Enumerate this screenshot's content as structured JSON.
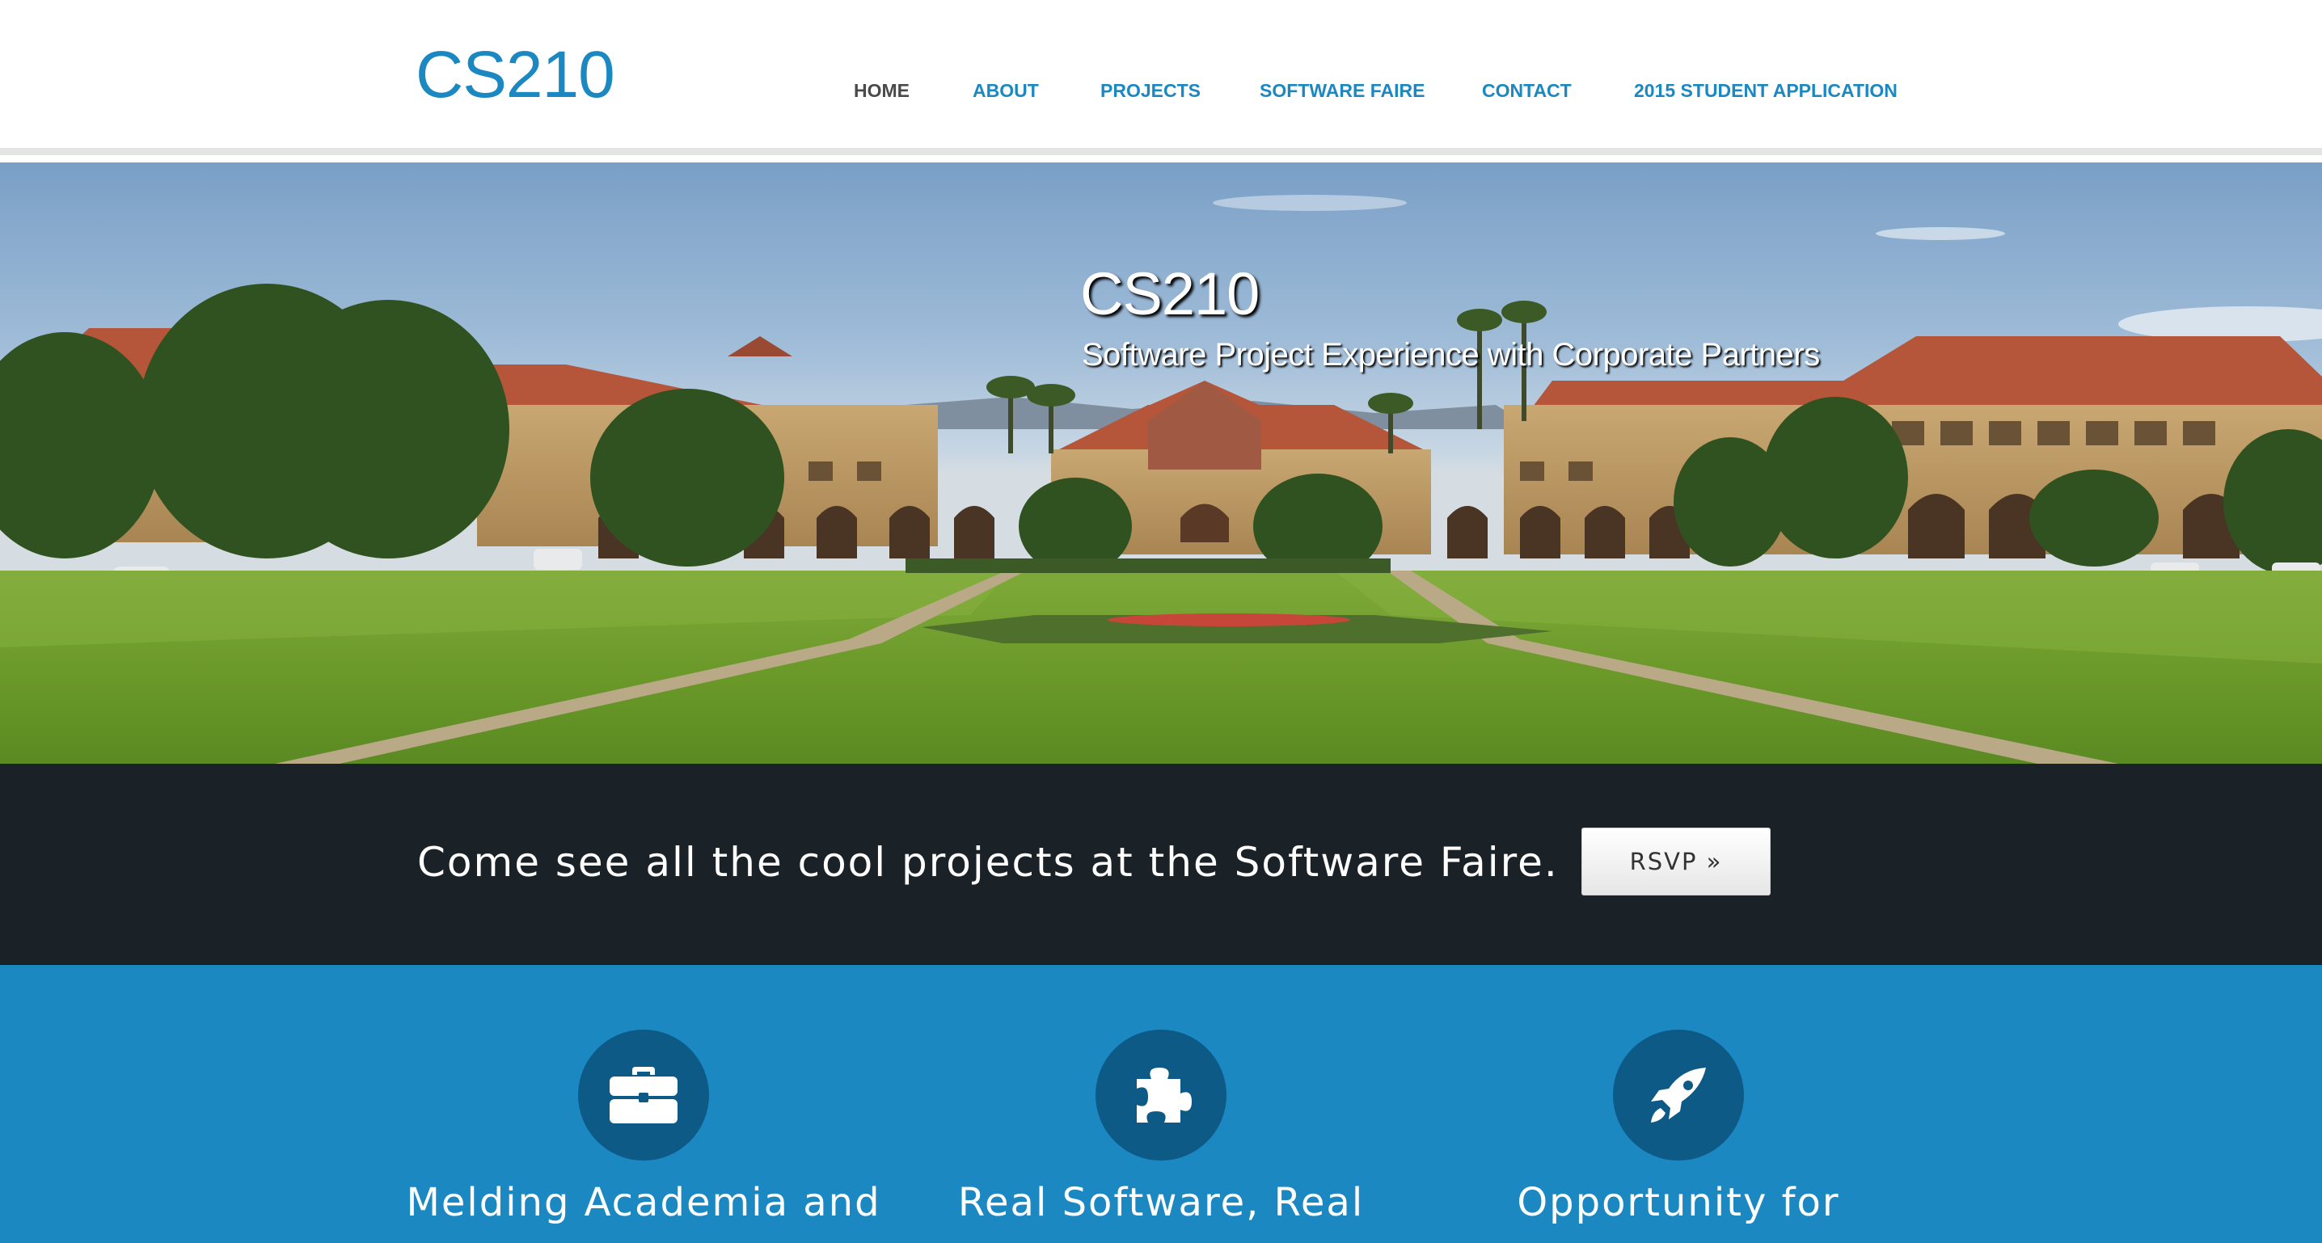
{
  "site": {
    "logo": "CS210"
  },
  "nav": {
    "items": [
      {
        "label": "HOME",
        "active": true
      },
      {
        "label": "ABOUT",
        "active": false
      },
      {
        "label": "PROJECTS",
        "active": false
      },
      {
        "label": "SOFTWARE FAIRE",
        "active": false
      },
      {
        "label": "CONTACT",
        "active": false
      },
      {
        "label": "2015 STUDENT APPLICATION",
        "active": false
      }
    ]
  },
  "hero": {
    "title": "CS210",
    "subtitle": "Software Project Experience with Corporate Partners",
    "image_description_icon": "campus-photo"
  },
  "cta": {
    "text": "Come see all the cool projects at the Software Faire.",
    "button_label": "RSVP »"
  },
  "features": [
    {
      "icon": "briefcase-icon",
      "title": "Melding Academia and"
    },
    {
      "icon": "puzzle-piece-icon",
      "title": "Real Software, Real"
    },
    {
      "icon": "rocket-icon",
      "title": "Opportunity for"
    }
  ],
  "colors": {
    "brand_blue": "#1b88c2",
    "nav_active": "#4a4a4a",
    "cta_background": "#1b2227",
    "icon_circle": "#0e5a86"
  }
}
